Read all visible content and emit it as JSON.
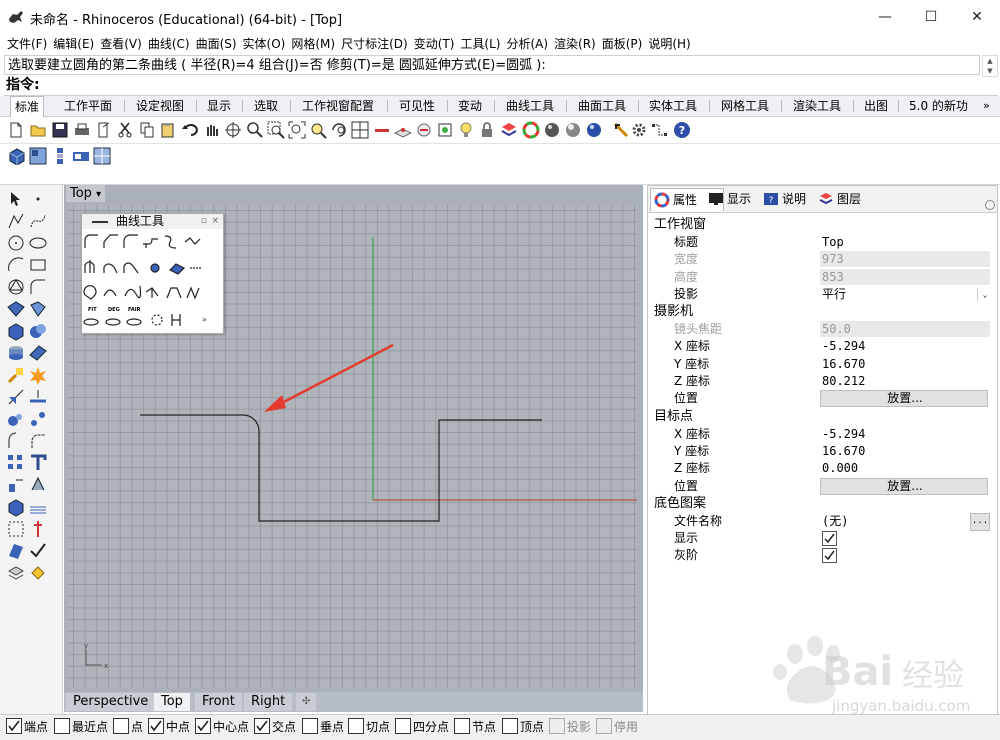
{
  "window": {
    "title": "未命名 - Rhinoceros (Educational) (64-bit) - [Top]",
    "minimize": "—",
    "maximize": "☐",
    "close": "✕"
  },
  "menu": [
    "文件(F)",
    "编辑(E)",
    "查看(V)",
    "曲线(C)",
    "曲面(S)",
    "实体(O)",
    "网格(M)",
    "尺寸标注(D)",
    "变动(T)",
    "工具(L)",
    "分析(A)",
    "渲染(R)",
    "面板(P)",
    "说明(H)"
  ],
  "command": {
    "history": "选取要建立圆角的第二条曲线 ( 半径(R)=4  组合(J)=否  修剪(T)=是  圆弧延伸方式(E)=圆弧 ):",
    "prompt": "指令:"
  },
  "toolbar_tabs": [
    "标准",
    "工作平面",
    "设定视图",
    "显示",
    "选取",
    "工作视窗配置",
    "可见性",
    "变动",
    "曲线工具",
    "曲面工具",
    "实体工具",
    "网格工具",
    "渲染工具",
    "出图",
    "5.0 的新功"
  ],
  "toolbar_tabs_more": "»",
  "viewport": {
    "label": "Top",
    "label_arrow": "▾",
    "axis_y": "y",
    "axis_x": "x"
  },
  "curve_panel": {
    "title": "曲线工具",
    "dot": "▫",
    "close": "×",
    "fit_label": "FIT",
    "deg_label": "DEG",
    "fair_label": "FAIR",
    "more": "»"
  },
  "viewport_tabs": [
    "Perspective",
    "Top",
    "Front",
    "Right"
  ],
  "viewport_tab_add": "✣",
  "panel": {
    "tabs": [
      "属性",
      "显示",
      "说明",
      "图层"
    ],
    "sections": {
      "viewport": "工作视窗",
      "camera": "摄影机",
      "target": "目标点",
      "wallpaper": "底色图案"
    },
    "rows": {
      "title_key": "标题",
      "title_val": "Top",
      "width_key": "宽度",
      "width_val": "973",
      "height_key": "高度",
      "height_val": "853",
      "projection_key": "投影",
      "projection_val": "平行",
      "lens_key": "镜头焦距",
      "lens_val": "50.0",
      "cam_x_key": "X 座标",
      "cam_x_val": "-5.294",
      "cam_y_key": "Y 座标",
      "cam_y_val": "16.670",
      "cam_z_key": "Z 座标",
      "cam_z_val": "80.212",
      "cam_pos_key": "位置",
      "cam_pos_btn": "放置...",
      "tgt_x_key": "X 座标",
      "tgt_x_val": "-5.294",
      "tgt_y_key": "Y 座标",
      "tgt_y_val": "16.670",
      "tgt_z_key": "Z 座标",
      "tgt_z_val": "0.000",
      "tgt_pos_key": "位置",
      "tgt_pos_btn": "放置...",
      "file_key": "文件名称",
      "file_val": "(无)",
      "file_btn": "...",
      "show_key": "显示",
      "gray_key": "灰阶"
    }
  },
  "osnaps": [
    {
      "label": "端点",
      "checked": true
    },
    {
      "label": "最近点",
      "checked": false
    },
    {
      "label": "点",
      "checked": false
    },
    {
      "label": "中点",
      "checked": true
    },
    {
      "label": "中心点",
      "checked": true
    },
    {
      "label": "交点",
      "checked": true
    },
    {
      "label": "垂点",
      "checked": false
    },
    {
      "label": "切点",
      "checked": false
    },
    {
      "label": "四分点",
      "checked": false
    },
    {
      "label": "节点",
      "checked": false
    },
    {
      "label": "顶点",
      "checked": false
    },
    {
      "label": "投影",
      "checked": false,
      "disabled": true
    },
    {
      "label": "停用",
      "checked": false,
      "disabled": true
    }
  ],
  "watermark": {
    "brand": "Bai",
    "brand2": "经验",
    "url": "jingyan.baidu.com"
  },
  "colors": {
    "accent": "#0078d7",
    "x_axis": "#c0392b",
    "y_axis": "#27a23c",
    "arrow": "#e53a2f",
    "viewport_bg": "#aeb4ba"
  }
}
